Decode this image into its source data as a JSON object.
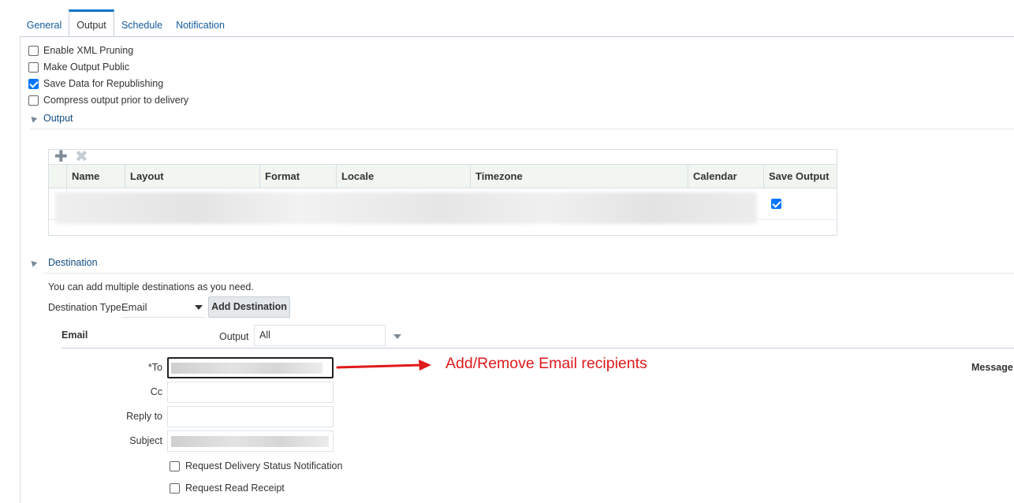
{
  "tabs": [
    {
      "label": "General"
    },
    {
      "label": "Output"
    },
    {
      "label": "Schedule"
    },
    {
      "label": "Notification"
    }
  ],
  "active_tab": "Output",
  "options": [
    {
      "label": "Enable XML Pruning",
      "checked": false
    },
    {
      "label": "Make Output Public",
      "checked": false
    },
    {
      "label": "Save Data for Republishing",
      "checked": true
    },
    {
      "label": "Compress output prior to delivery",
      "checked": false
    }
  ],
  "output_section": {
    "title": "Output",
    "toolbar": {
      "add_icon": "plus-icon",
      "remove_icon": "close-icon"
    },
    "columns": [
      "Name",
      "Layout",
      "Format",
      "Locale",
      "Timezone",
      "Calendar",
      "Save Output"
    ],
    "row": {
      "save_output": true
    }
  },
  "destination_section": {
    "title": "Destination",
    "hint": "You can add multiple destinations as you need.",
    "type_label": "Destination Type",
    "type_value": "Email",
    "add_button": "Add Destination",
    "email": {
      "header": "Email",
      "output_label": "Output",
      "output_value": "All",
      "to_label": "*To",
      "cc_label": "Cc",
      "reply_to_label": "Reply to",
      "subject_label": "Subject",
      "message_label": "Message",
      "delivery_status": "Request Delivery Status Notification",
      "read_receipt": "Request Read Receipt"
    }
  },
  "annotation": {
    "text": "Add/Remove Email recipients",
    "color": "#e0191b"
  },
  "colors": {
    "link": "#145c9e",
    "accent": "#0572ce",
    "checkbox": "#0075ff"
  }
}
